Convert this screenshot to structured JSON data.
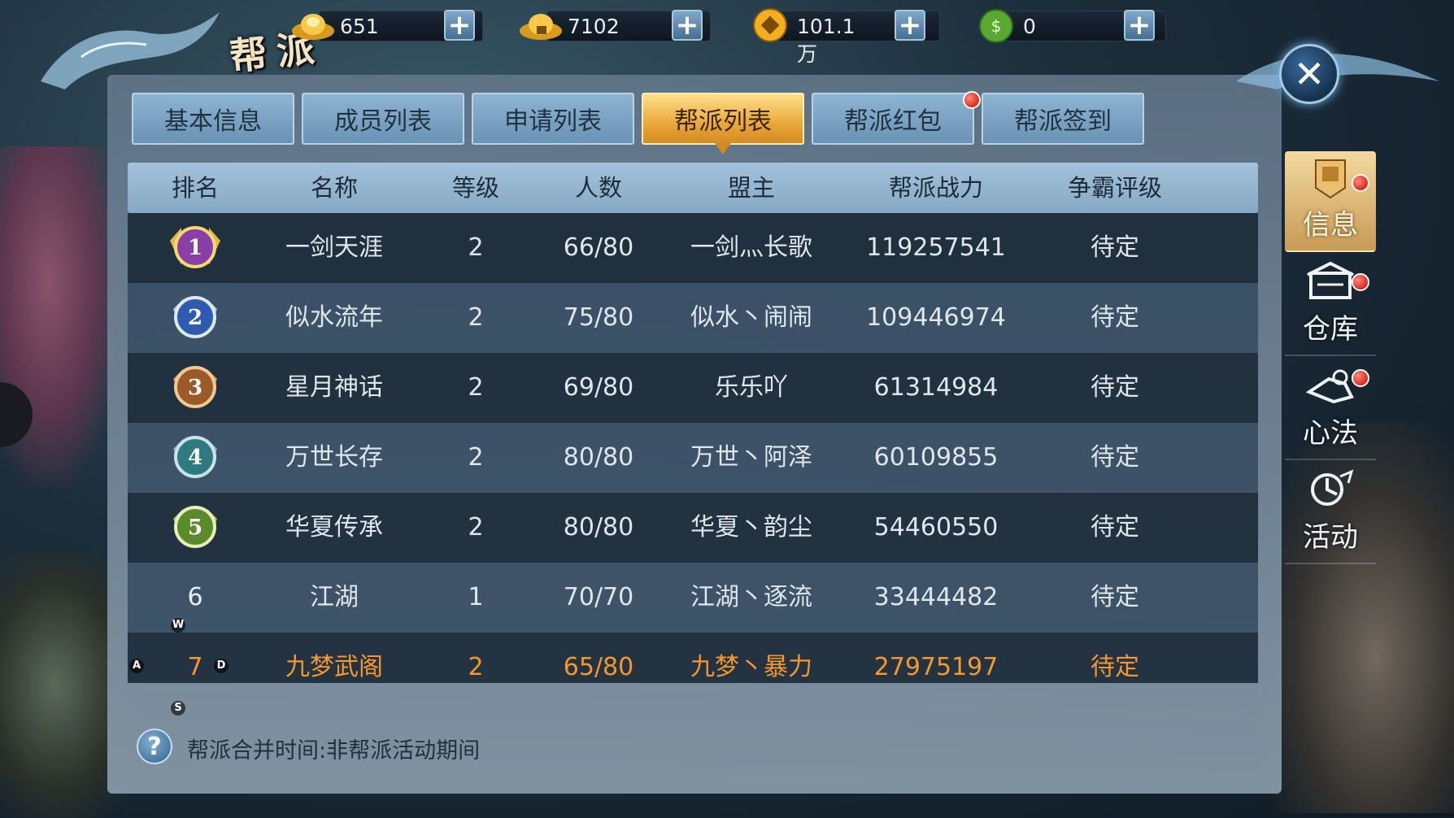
{
  "currencies": [
    {
      "icon": "gold-ingot-icon",
      "value": "651"
    },
    {
      "icon": "bound-gold-ingot-icon",
      "value": "7102"
    },
    {
      "icon": "gold-coin-icon",
      "value": "101.1万"
    },
    {
      "icon": "jade-icon",
      "value": "0"
    }
  ],
  "title": "帮派",
  "tabs": [
    {
      "label": "基本信息",
      "active": false,
      "badge": false
    },
    {
      "label": "成员列表",
      "active": false,
      "badge": false
    },
    {
      "label": "申请列表",
      "active": false,
      "badge": false
    },
    {
      "label": "帮派列表",
      "active": true,
      "badge": false
    },
    {
      "label": "帮派红包",
      "active": false,
      "badge": true
    },
    {
      "label": "帮派签到",
      "active": false,
      "badge": false
    }
  ],
  "table": {
    "headers": [
      "排名",
      "名称",
      "等级",
      "人数",
      "盟主",
      "帮派战力",
      "争霸评级"
    ],
    "rows": [
      {
        "rank": "1",
        "name": "一剑天涯",
        "level": "2",
        "members": "66/80",
        "leader": "一剑灬长歌",
        "power": "119257541",
        "rating": "待定"
      },
      {
        "rank": "2",
        "name": "似水流年",
        "level": "2",
        "members": "75/80",
        "leader": "似水丶闹闹",
        "power": "109446974",
        "rating": "待定"
      },
      {
        "rank": "3",
        "name": "星月神话",
        "level": "2",
        "members": "69/80",
        "leader": "乐乐吖",
        "power": "61314984",
        "rating": "待定"
      },
      {
        "rank": "4",
        "name": "万世长存",
        "level": "2",
        "members": "80/80",
        "leader": "万世丶阿泽",
        "power": "60109855",
        "rating": "待定"
      },
      {
        "rank": "5",
        "name": "华夏传承",
        "level": "2",
        "members": "80/80",
        "leader": "华夏丶韵尘",
        "power": "54460550",
        "rating": "待定"
      },
      {
        "rank": "6",
        "name": "江湖",
        "level": "1",
        "members": "70/70",
        "leader": "江湖丶逐流",
        "power": "33444482",
        "rating": "待定"
      },
      {
        "rank": "7",
        "name": "九梦武阁",
        "level": "2",
        "members": "65/80",
        "leader": "九梦丶暴力",
        "power": "27975197",
        "rating": "待定"
      }
    ]
  },
  "key_hints": {
    "w": "W",
    "a": "A",
    "s": "S",
    "d": "D"
  },
  "footer": {
    "merge_time": "帮派合并时间:非帮派活动期间"
  },
  "side_menu": [
    {
      "label": "信息",
      "icon": "banner-icon",
      "active": true,
      "badge": true
    },
    {
      "label": "仓库",
      "icon": "warehouse-icon",
      "active": false,
      "badge": true
    },
    {
      "label": "心法",
      "icon": "skill-icon",
      "active": false,
      "badge": true
    },
    {
      "label": "活动",
      "icon": "activity-icon",
      "active": false,
      "badge": false
    }
  ],
  "colors": {
    "active_tab": "#e9a83a",
    "own_guild_text": "#f4972e",
    "badge": "#e02818"
  }
}
